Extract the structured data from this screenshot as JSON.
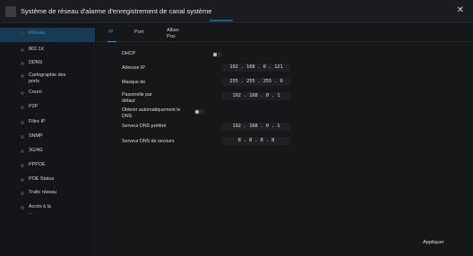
{
  "window": {
    "title": "Système de réseau d'alarme d'enregistrement de canal système",
    "close_glyph": "✕",
    "app_icon": "app-icon"
  },
  "sidebar": {
    "items": [
      {
        "label": "Réseau",
        "active": true
      },
      {
        "label": "802.1X"
      },
      {
        "label": "DDNS"
      },
      {
        "label": "Cartographie des ports"
      },
      {
        "label": "Courri"
      },
      {
        "label": "P2P"
      },
      {
        "label": "Filtre IP"
      },
      {
        "label": "SNMP"
      },
      {
        "label": "3G/4G"
      },
      {
        "label": "PPPOE"
      },
      {
        "label": "POE Status"
      },
      {
        "label": "Trafic réseau"
      },
      {
        "label": "Accès à la ..."
      }
    ]
  },
  "tabs": [
    {
      "label": "IP",
      "active": true
    },
    {
      "label": "Port"
    },
    {
      "label": "Allian Pos"
    }
  ],
  "form": {
    "dhcp_label": "DHCP",
    "dhcp_enabled": false,
    "ip_label": "Adresse IP",
    "ip_value": "192 . 168 .  0  . 121",
    "mask_label": "Masque de",
    "mask_value": "255 . 255 . 255 .  0",
    "gateway_label": "Passerelle par défaut",
    "gateway_value": "192 . 168 .  0  .  1",
    "auto_dns_label": "Obtenir automatiquement le DNS",
    "auto_dns_enabled": false,
    "dns1_label": "Serveur DNS préféré",
    "dns1_value": "192 . 168 .  0  .  1",
    "dns2_label": "Serveur DNS de secours",
    "dns2_value": " 8  .  8  .  8  .  8"
  },
  "footer": {
    "apply_label": "Appliquer"
  },
  "colors": {
    "accent": "#2e9bdc",
    "active_bg": "#173b55",
    "background": "#0f1012"
  }
}
